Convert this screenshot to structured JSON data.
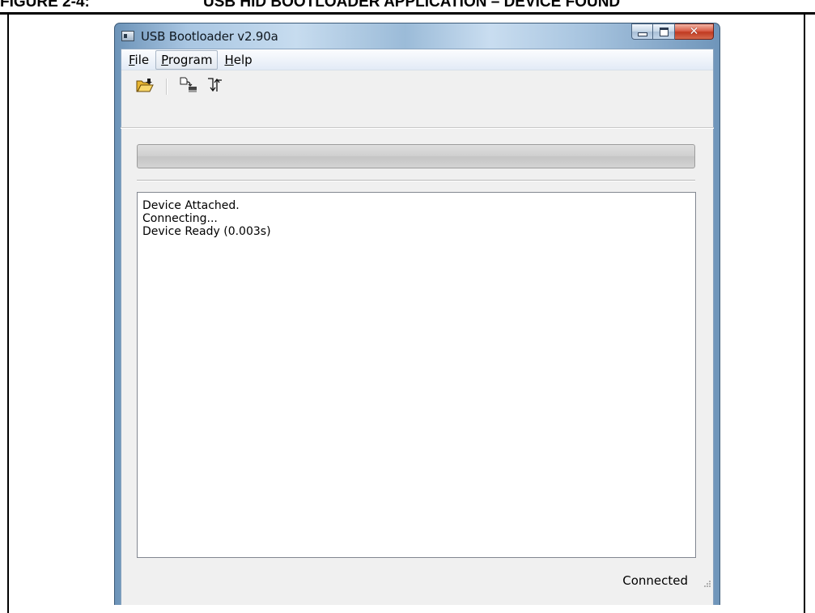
{
  "figure": {
    "number": "FIGURE 2-4:",
    "title": "USB HID BOOTLOADER APPLICATION – DEVICE FOUND"
  },
  "window": {
    "title": "USB Bootloader v2.90a",
    "caption_buttons": {
      "minimize": "minimize-icon",
      "maximize": "maximize-icon",
      "close": "close-icon"
    }
  },
  "menu": {
    "file": {
      "accel": "F",
      "rest": "ile"
    },
    "program": {
      "accel": "P",
      "rest": "rogram"
    },
    "help": {
      "accel": "H",
      "rest": "elp"
    }
  },
  "toolbar": {
    "open": "open-folder-icon",
    "program_device": "program-device-icon",
    "reset_device": "reset-device-icon"
  },
  "progress": {
    "value_percent": 0
  },
  "log": {
    "lines": [
      "Device Attached.",
      "Connecting...",
      "Device Ready (0.003s)"
    ]
  },
  "status": {
    "text": "Connected"
  },
  "colors": {
    "titlebar_accent": "#a9c6e2",
    "close_button": "#c03a21",
    "client_bg": "#f0f0f0"
  }
}
